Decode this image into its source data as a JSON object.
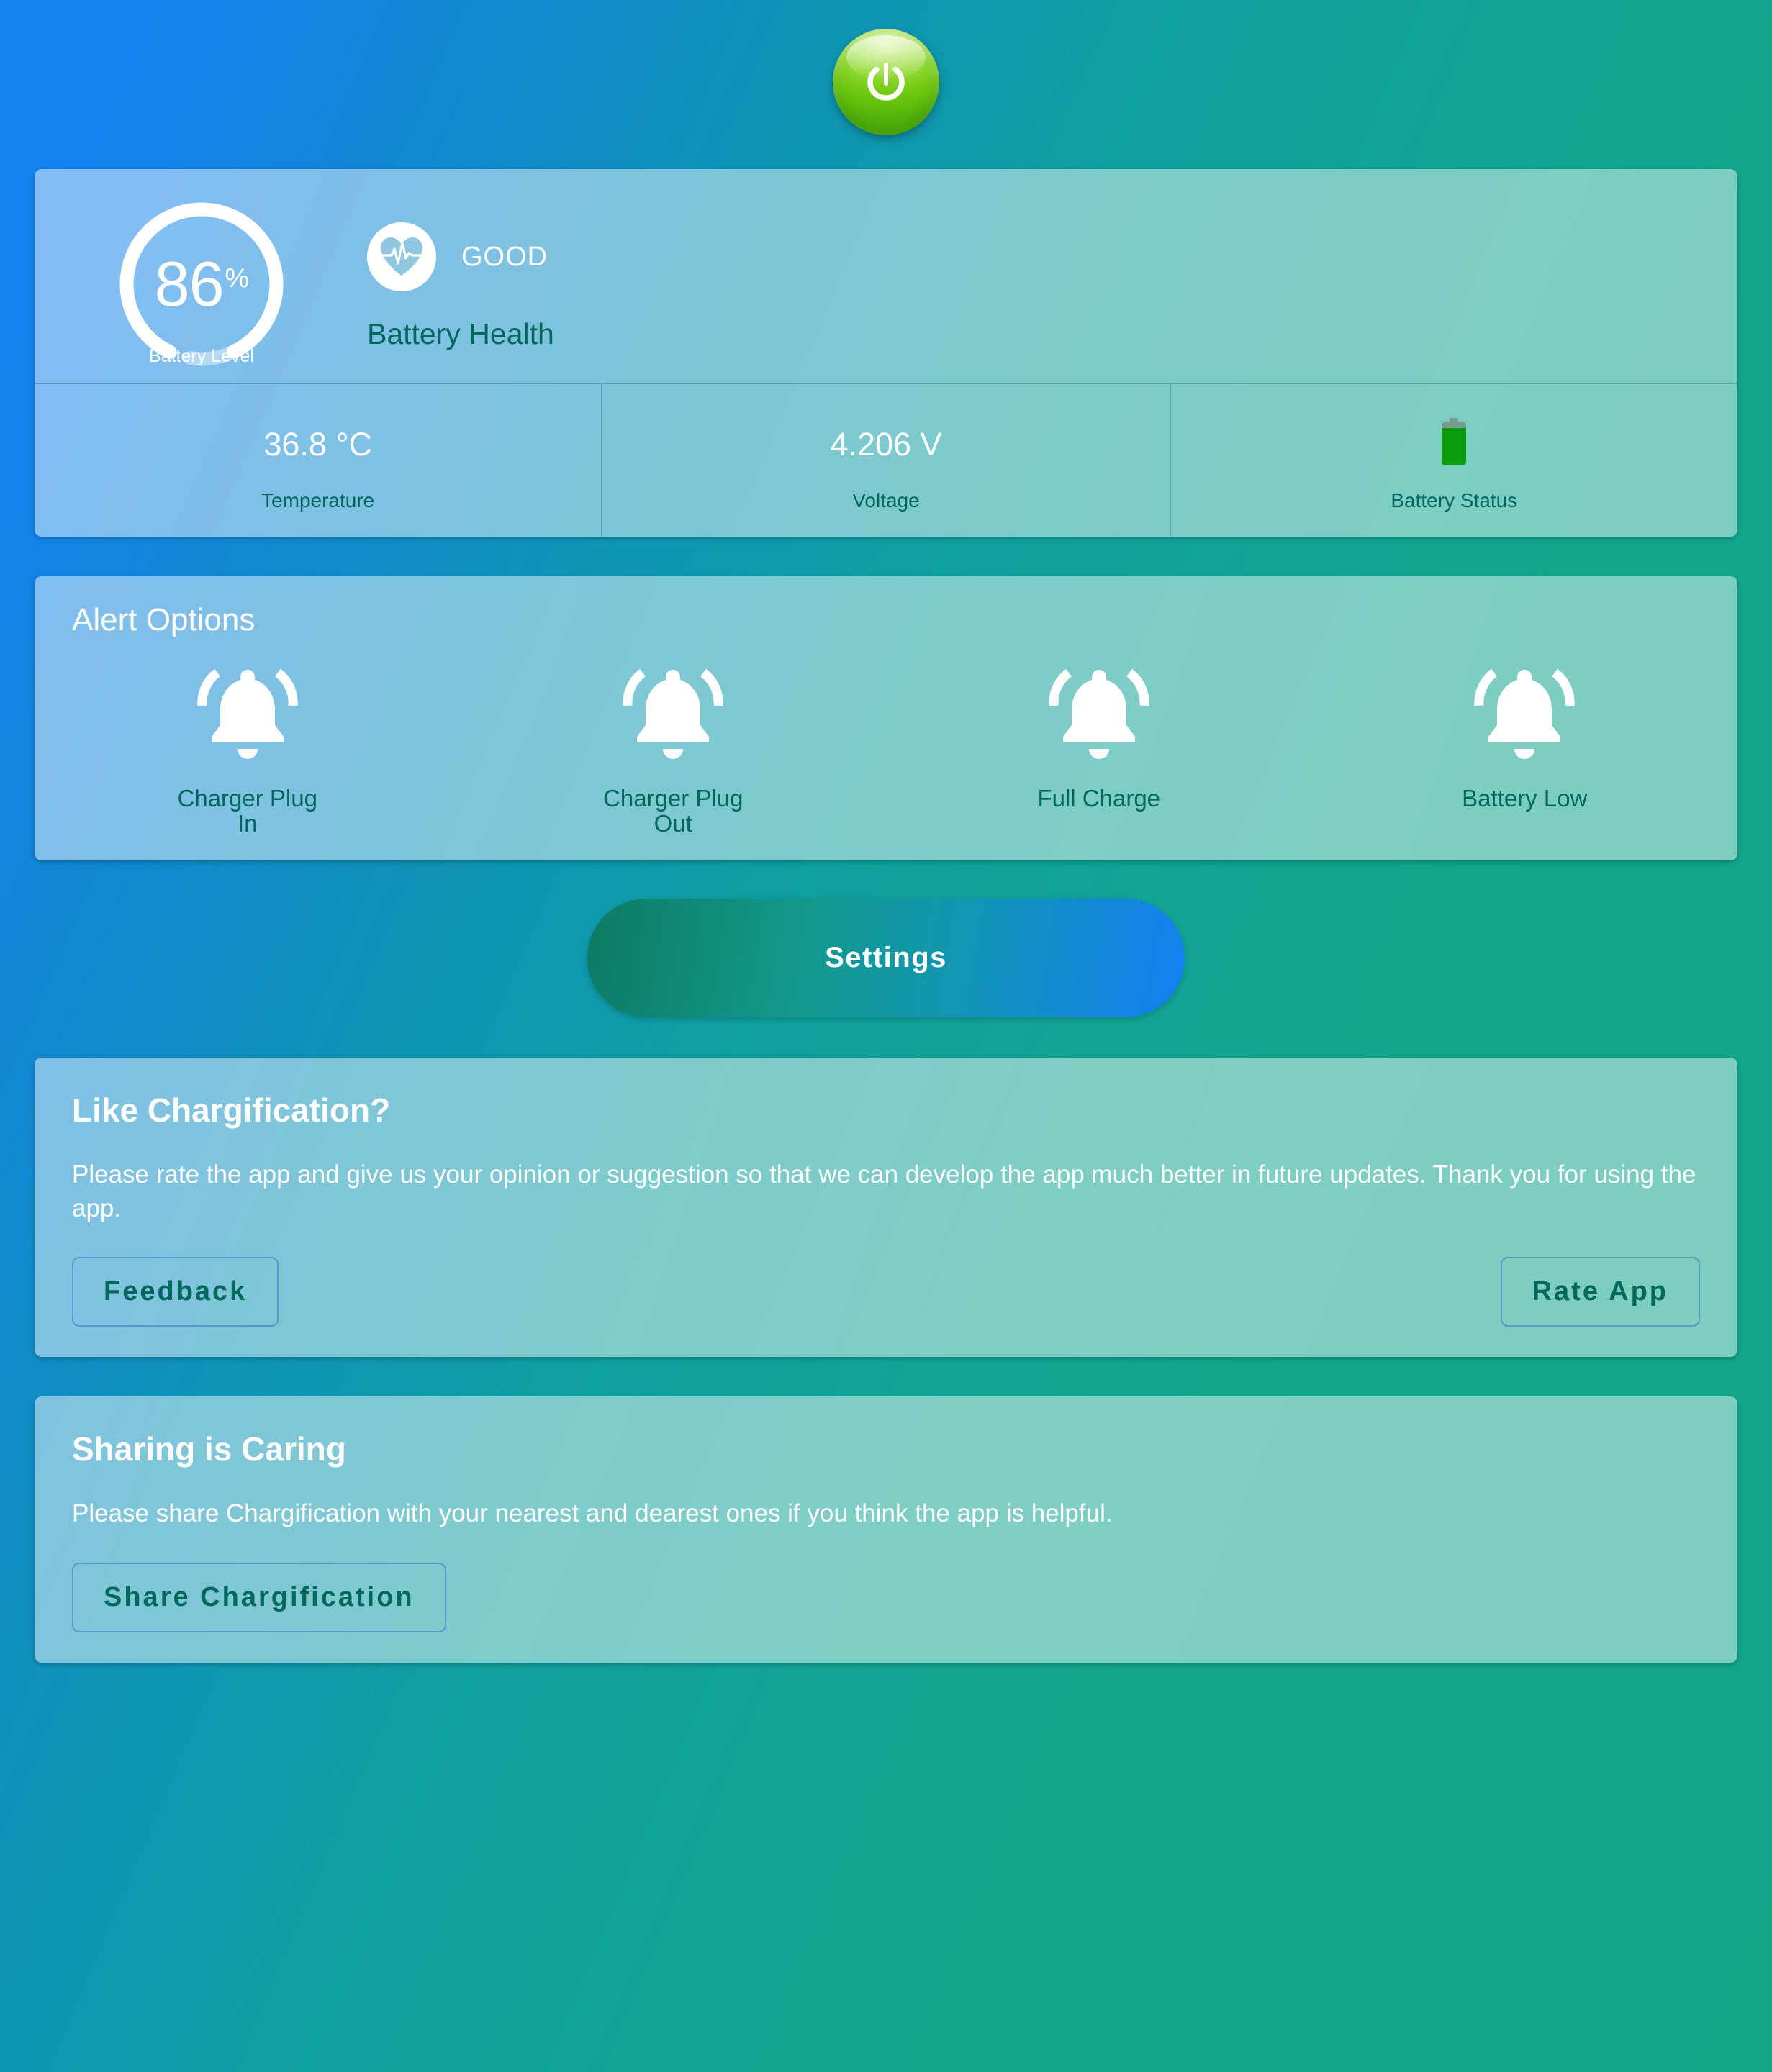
{
  "header": {
    "power_button": {
      "icon": "power-icon",
      "label": "Power"
    }
  },
  "status_card": {
    "battery_level": {
      "value": "86",
      "unit": "%",
      "caption": "Battery Level",
      "percent": 86
    },
    "health": {
      "icon": "heart-pulse-icon",
      "status": "GOOD",
      "label": "Battery Health"
    },
    "metrics": [
      {
        "value": "36.8 °C",
        "label": "Temperature"
      },
      {
        "value": "4.206 V",
        "label": "Voltage"
      },
      {
        "value": "",
        "label": "Battery Status",
        "icon": "battery-icon"
      }
    ]
  },
  "alerts": {
    "title": "Alert Options",
    "items": [
      {
        "icon": "bell-icon",
        "label": "Charger Plug In"
      },
      {
        "icon": "bell-icon",
        "label": "Charger Plug Out"
      },
      {
        "icon": "bell-icon",
        "label": "Full Charge"
      },
      {
        "icon": "bell-icon",
        "label": "Battery Low"
      }
    ]
  },
  "settings_button": {
    "label": "Settings"
  },
  "rate_card": {
    "title": "Like Chargification?",
    "body": "Please rate the app and give us your opinion or suggestion so that we can develop the app much better in future updates. Thank you for using the app.",
    "feedback_label": "Feedback",
    "rate_label": "Rate App"
  },
  "share_card": {
    "title": "Sharing is Caring",
    "body": "Please share Chargification with your nearest and dearest ones if you think the app is helpful.",
    "share_label": "Share Chargification"
  },
  "colors": {
    "bg_start": "#1583f2",
    "bg_end": "#12a689",
    "accent_green": "#8fd92f",
    "teal_text": "#00695c",
    "battery_fill": "#0a9c0a",
    "battery_cap": "#7a9a96"
  }
}
